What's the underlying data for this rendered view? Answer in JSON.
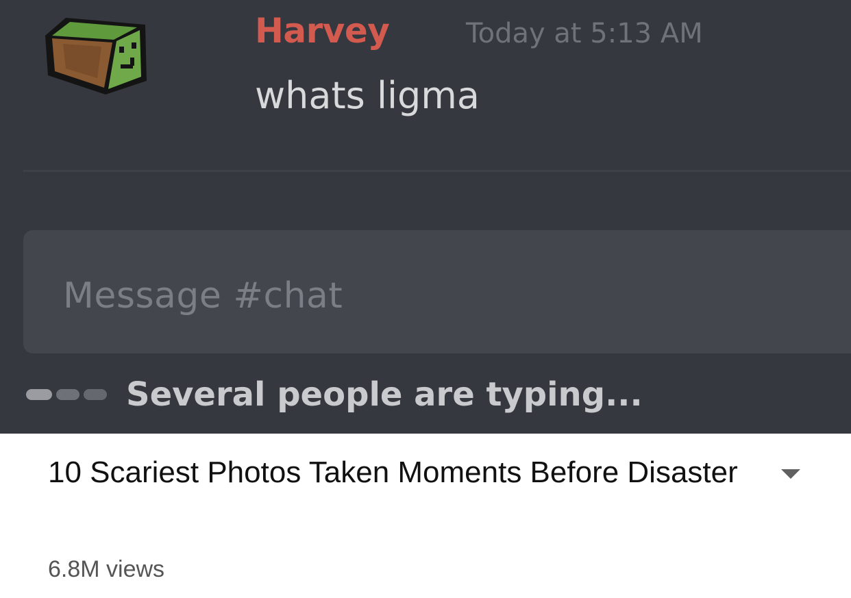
{
  "chat": {
    "message": {
      "author": "Harvey",
      "timestamp": "Today at 5:13 AM",
      "text": "whats ligma",
      "author_color": "#d25a4f",
      "avatar_icon": "cube-face-avatar-icon"
    },
    "input": {
      "placeholder": "Message #chat"
    },
    "typing_indicator": {
      "icon": "typing-dots-icon",
      "text": "Several people are typing..."
    },
    "background": "#36383f"
  },
  "video": {
    "title": "10 Scariest Photos Taken Moments Before Disaster",
    "views": "6.8M views",
    "expand_icon": "chevron-down-icon"
  }
}
